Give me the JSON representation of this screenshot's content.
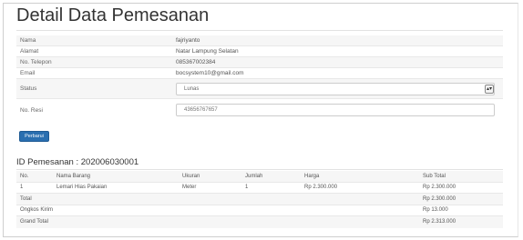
{
  "page": {
    "title": "Detail Data Pemesanan"
  },
  "customer": {
    "rows": [
      {
        "label": "Nama",
        "value": "fajriyanto"
      },
      {
        "label": "Alamat",
        "value": "Natar Lampung Selatan"
      },
      {
        "label": "No. Telepon",
        "value": "085367002384"
      },
      {
        "label": "Email",
        "value": "bocsystem10@gmail.com"
      }
    ],
    "status_label": "Status",
    "status_value": "Lunas",
    "resi_label": "No. Resi",
    "resi_value": "43656767657"
  },
  "actions": {
    "update_label": "Perbarui"
  },
  "order": {
    "id_text": "ID Pemesanan : 202006030001",
    "headers": [
      "No.",
      "Nama Barang",
      "Ukuran",
      "Jumlah",
      "Harga",
      "Sub Total"
    ],
    "items": [
      {
        "no": "1",
        "name": "Lemari Hias Pakaian",
        "size": "Meter",
        "qty": "1",
        "price": "Rp 2.300.000",
        "subtotal": "Rp 2.300.000"
      }
    ],
    "summary": [
      {
        "label": "Total",
        "value": "Rp 2.300.000"
      },
      {
        "label": "Ongkos Kirim",
        "value": "Rp 13.000"
      },
      {
        "label": "Grand Total",
        "value": "Rp 2.313.000"
      }
    ]
  }
}
